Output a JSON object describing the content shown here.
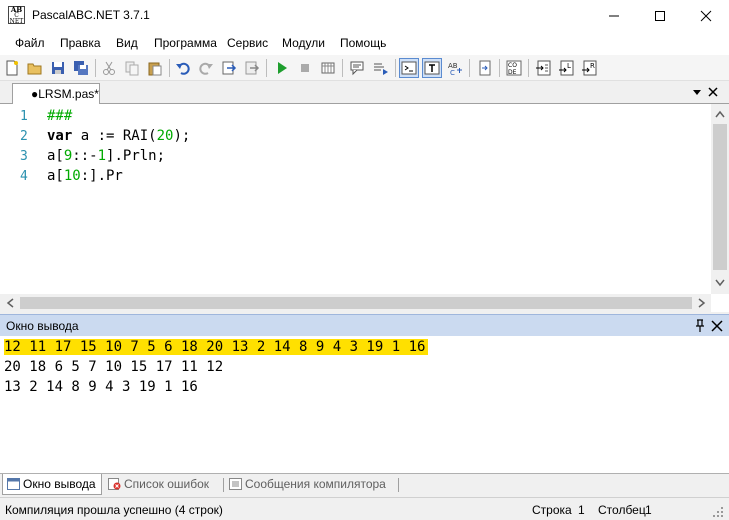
{
  "window": {
    "title": "PascalABC.NET 3.7.1",
    "icon_text": [
      "AB",
      "C",
      "NET"
    ]
  },
  "menu": [
    "Файл",
    "Правка",
    "Вид",
    "Программа",
    "Сервис",
    "Модули",
    "Помощь"
  ],
  "toolbar": {
    "buttons": [
      "new-file-icon",
      "open-file-icon",
      "save-icon",
      "save-all-icon",
      "cut-icon",
      "copy-icon",
      "paste-icon",
      "undo-icon",
      "redo-icon",
      "compile-icon",
      "build-icon",
      "run-icon",
      "stop-icon",
      "debug-icon",
      "comment-icon",
      "uncomment-icon",
      "console-icon",
      "text-icon",
      "format-icon",
      "navigate-icon",
      "code-icon",
      "step-into-icon",
      "step-over-icon",
      "step-out-icon"
    ]
  },
  "editor_tab": {
    "label": "●LRSM.pas*"
  },
  "editor": {
    "line_numbers": [
      "1",
      "2",
      "3",
      "4"
    ],
    "lines": [
      "###",
      "var a := RAI(20);",
      "a[9::-1].Prln;",
      "a[10:].Pr"
    ]
  },
  "output": {
    "title": "Окно вывода",
    "lines": [
      "12 11 17 15 10 7 5 6 18 20 13 2 14 8 9 4 3 19 1 16",
      "20 18 6 5 7 10 15 17 11 12",
      "13 2 14 8 9 4 3 19 1 16"
    ]
  },
  "bottom_tabs": [
    "Окно вывода",
    "Список ошибок",
    "Сообщения компилятора"
  ],
  "status": {
    "message": "Компиляция прошла успешно (4 строк)",
    "row_label": "Строка",
    "row": "1",
    "col_label": "Столбец",
    "col": "1"
  },
  "colors": {
    "output_highlight": "#ffe000",
    "output_header": "#cbdaf0",
    "line_numbers": "#2b91af",
    "numbers": "#00aa00"
  }
}
